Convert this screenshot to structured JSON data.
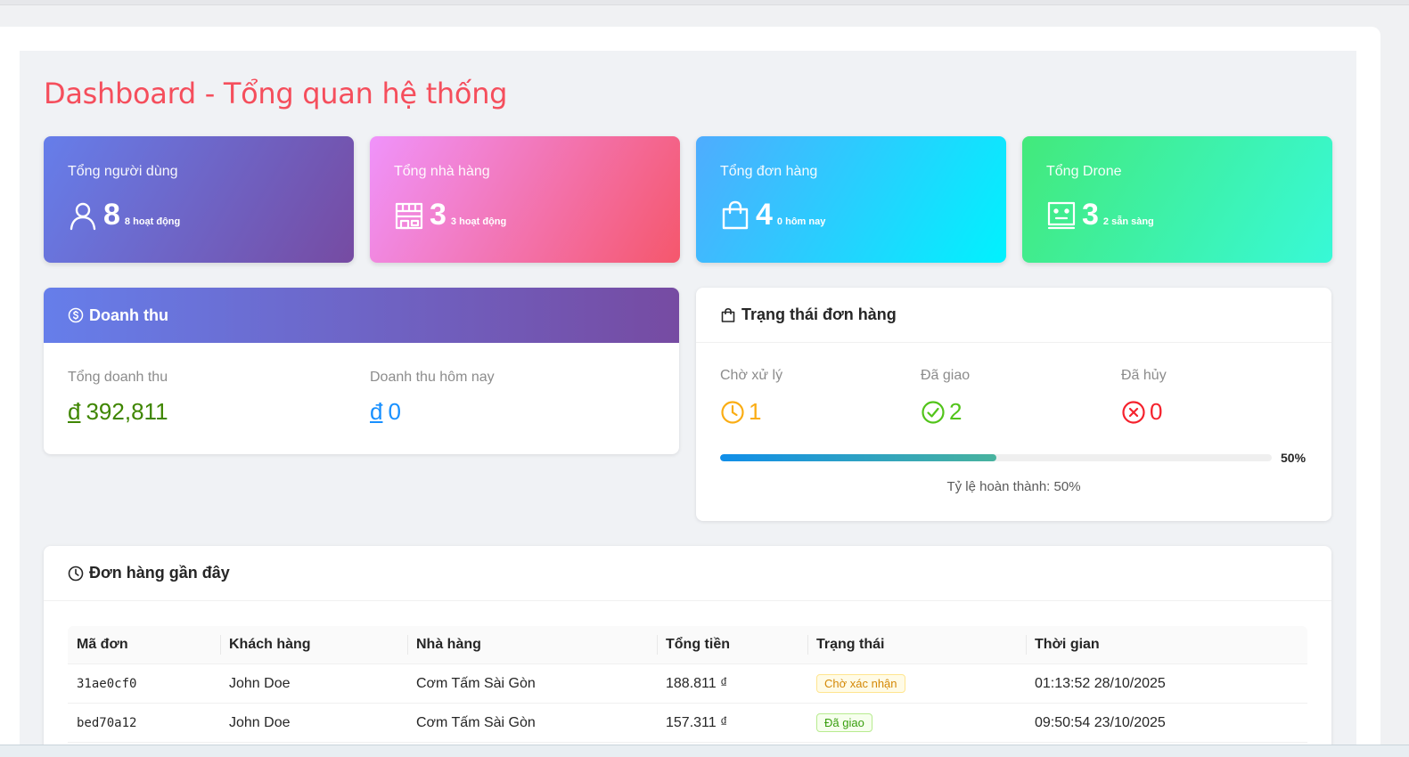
{
  "page": {
    "title": "Dashboard - Tổng quan hệ thống"
  },
  "stats": [
    {
      "label": "Tổng người dùng",
      "value": "8",
      "sub": "8 hoạt động",
      "icon": "user-icon"
    },
    {
      "label": "Tổng nhà hàng",
      "value": "3",
      "sub": "3 hoạt động",
      "icon": "shop-icon"
    },
    {
      "label": "Tổng đơn hàng",
      "value": "4",
      "sub": "0 hôm nay",
      "icon": "shopping-bag-icon"
    },
    {
      "label": "Tổng Drone",
      "value": "3",
      "sub": "2 sẵn sàng",
      "icon": "robot-icon"
    }
  ],
  "revenue": {
    "title": "Doanh thu",
    "total_label": "Tổng doanh thu",
    "total_currency": "đ",
    "total_value": "392,811",
    "today_label": "Doanh thu hôm nay",
    "today_currency": "đ",
    "today_value": "0",
    "colors": {
      "total": "#3f8600",
      "today": "#1890ff"
    }
  },
  "order_status": {
    "title": "Trạng thái đơn hàng",
    "pending_label": "Chờ xử lý",
    "pending_value": "1",
    "delivered_label": "Đã giao",
    "delivered_value": "2",
    "cancelled_label": "Đã hủy",
    "cancelled_value": "0",
    "progress_percent": 50,
    "progress_label": "50%",
    "completion_text": "Tỷ lệ hoàn thành: 50%",
    "colors": {
      "pending": "#faad14",
      "delivered": "#52c41a",
      "cancelled": "#f5222d"
    }
  },
  "recent_orders": {
    "title": "Đơn hàng gần đây",
    "columns": [
      "Mã đơn",
      "Khách hàng",
      "Nhà hàng",
      "Tổng tiền",
      "Trạng thái",
      "Thời gian"
    ],
    "rows": [
      {
        "id": "31ae0cf0",
        "customer": "John Doe",
        "restaurant": "Cơm Tấm Sài Gòn",
        "total": "188.811 ₫",
        "status": "Chờ xác nhận",
        "time": "01:13:52 28/10/2025"
      },
      {
        "id": "bed70a12",
        "customer": "John Doe",
        "restaurant": "Cơm Tấm Sài Gòn",
        "total": "157.311 ₫",
        "status": "Đã giao",
        "time": "09:50:54 23/10/2025"
      }
    ]
  }
}
